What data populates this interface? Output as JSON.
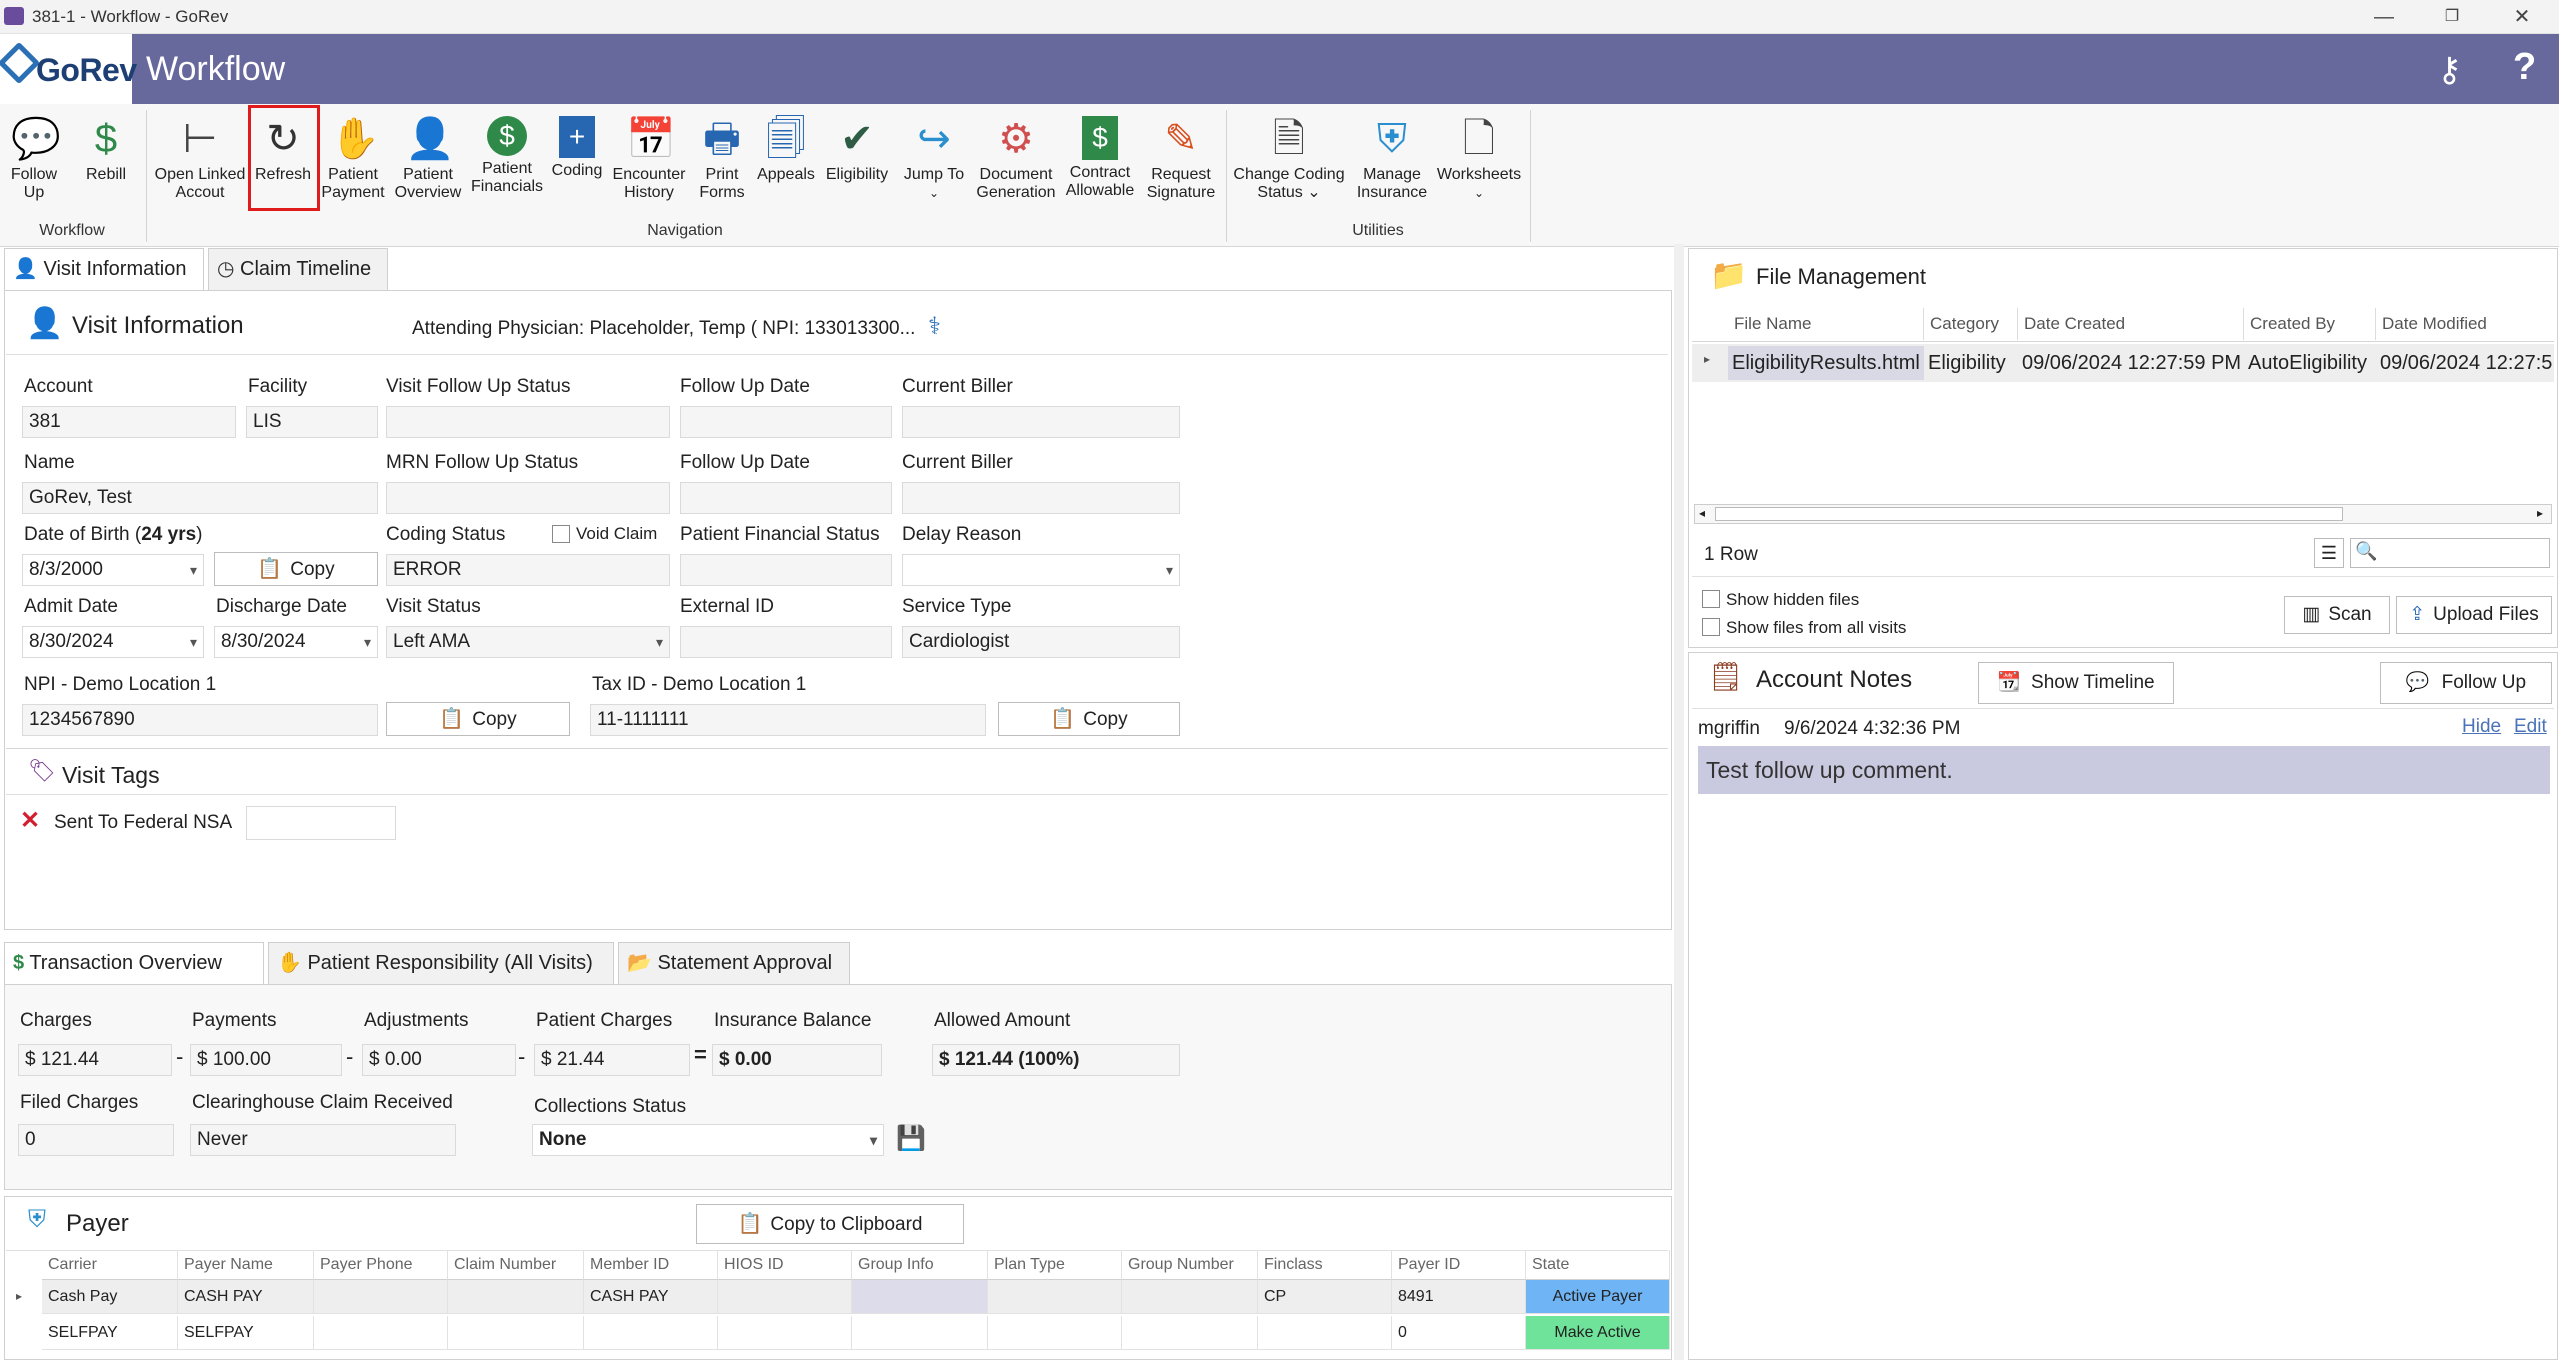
{
  "window": {
    "title": "381-1 - Workflow - GoRev",
    "minimize": "—",
    "maximize": "❐",
    "close": "✕"
  },
  "header": {
    "logo": "GoRev",
    "module": "Workflow"
  },
  "ribbon": {
    "workflow": {
      "group": "Workflow",
      "follow_up": [
        "Follow",
        "Up"
      ],
      "rebill": "Rebill"
    },
    "navigation": {
      "group": "Navigation",
      "open_linked": [
        "Open Linked",
        "Accout"
      ],
      "refresh": "Refresh",
      "patient_payment": [
        "Patient",
        "Payment"
      ],
      "patient_overview": [
        "Patient",
        "Overview"
      ],
      "patient_financials": [
        "Patient",
        "Financials"
      ],
      "coding": "Coding",
      "encounter_history": [
        "Encounter",
        "History"
      ],
      "print_forms": [
        "Print",
        "Forms"
      ],
      "appeals": "Appeals",
      "eligibility": "Eligibility",
      "jump_to": "Jump To",
      "document_generation": [
        "Document",
        "Generation"
      ],
      "contract_allowable": [
        "Contract",
        "Allowable"
      ],
      "request_signature": [
        "Request",
        "Signature"
      ]
    },
    "utilities": {
      "group": "Utilities",
      "change_coding_status": [
        "Change Coding",
        "Status ⌄"
      ],
      "manage_insurance": [
        "Manage",
        "Insurance"
      ],
      "worksheets": "Worksheets"
    }
  },
  "tabs": {
    "visit_information": "Visit Information",
    "claim_timeline": "Claim Timeline"
  },
  "visit_info": {
    "title": "Visit Information",
    "attending": "Attending Physician: Placeholder, Temp ( NPI: 133013300...",
    "account_label": "Account",
    "account": "381",
    "facility_label": "Facility",
    "facility": "LIS",
    "visit_follow_up_status_label": "Visit Follow Up Status",
    "visit_follow_up_status": "",
    "follow_up_date_label": "Follow Up Date",
    "follow_up_date": "",
    "current_biller_label": "Current Biller",
    "current_biller": "",
    "name_label": "Name",
    "name": "GoRev, Test",
    "mrn_follow_up_status_label": "MRN Follow Up Status",
    "mrn_follow_up_status": "",
    "follow_up_date2_label": "Follow Up Date",
    "follow_up_date2": "",
    "current_biller2_label": "Current Biller",
    "current_biller2": "",
    "dob_label": "Date of Birth (",
    "dob_age": "24 yrs",
    "dob_label_end": ")",
    "dob": "8/3/2000",
    "copy": "Copy",
    "coding_status_label": "Coding Status",
    "coding_status": "ERROR",
    "void_claim_label": "Void Claim",
    "patient_financial_status_label": "Patient Financial Status",
    "patient_financial_status": "",
    "delay_reason_label": "Delay Reason",
    "delay_reason": "",
    "admit_date_label": "Admit Date",
    "admit_date": "8/30/2024",
    "discharge_date_label": "Discharge Date",
    "discharge_date": "8/30/2024",
    "visit_status_label": "Visit Status",
    "visit_status": "Left AMA",
    "external_id_label": "External ID",
    "external_id": "",
    "service_type_label": "Service Type",
    "service_type": "Cardiologist",
    "npi_label": "NPI - Demo Location 1",
    "npi": "1234567890",
    "tax_id_label": "Tax ID - Demo Location 1",
    "tax_id": "11-1111111"
  },
  "visit_tags": {
    "title": "Visit Tags",
    "tag": "Sent To Federal NSA",
    "tag_value": ""
  },
  "tabs2": {
    "transaction_overview": "Transaction Overview",
    "patient_responsibility": "Patient Responsibility (All Visits)",
    "statement_approval": "Statement Approval"
  },
  "transactions": {
    "charges_label": "Charges",
    "charges": "$ 121.44",
    "payments_label": "Payments",
    "payments": "$ 100.00",
    "adjustments_label": "Adjustments",
    "adjustments": "$ 0.00",
    "patient_charges_label": "Patient Charges",
    "patient_charges": "$ 21.44",
    "insurance_balance_label": "Insurance Balance",
    "insurance_balance": "$ 0.00",
    "allowed_amount_label": "Allowed Amount",
    "allowed_amount": "$ 121.44 (100%)",
    "op_minus": "-",
    "op_equals": "=",
    "filed_charges_label": "Filed Charges",
    "filed_charges": "0",
    "clearinghouse_label": "Clearinghouse Claim Received",
    "clearinghouse": "Never",
    "collections_status_label": "Collections Status",
    "collections_status": "None"
  },
  "payer": {
    "title": "Payer",
    "copy_clipboard": "Copy to Clipboard",
    "columns": [
      "Carrier",
      "Payer Name",
      "Payer Phone",
      "Claim Number",
      "Member ID",
      "HIOS ID",
      "Group Info",
      "Plan Type",
      "Group Number",
      "Finclass",
      "Payer ID",
      "State"
    ],
    "rows": [
      [
        "Cash Pay",
        "CASH PAY",
        "",
        "",
        "CASH PAY",
        "",
        "",
        "",
        "",
        "CP",
        "8491",
        "Active Payer"
      ],
      [
        "SELFPAY",
        "SELFPAY",
        "",
        "",
        "",
        "",
        "",
        "",
        "",
        "",
        "0",
        "Make Active"
      ]
    ]
  },
  "file_management": {
    "title": "File Management",
    "columns": [
      "File Name",
      "Category",
      "Date Created",
      "Created By",
      "Date Modified"
    ],
    "rows": [
      [
        "EligibilityResults.html",
        "Eligibility",
        "09/06/2024 12:27:59 PM",
        "AutoEligibility",
        "09/06/2024 12:27:5"
      ]
    ],
    "row_count": "1 Row",
    "show_hidden": "Show hidden files",
    "show_all_visits": "Show files from all visits",
    "scan": "Scan",
    "upload": "Upload Files"
  },
  "account_notes": {
    "title": "Account Notes",
    "show_timeline": "Show Timeline",
    "follow_up": "Follow Up",
    "note_author": "mgriffin",
    "note_time": "9/6/2024 4:32:36 PM",
    "hide": "Hide",
    "edit": "Edit",
    "note_text": "Test follow up comment."
  },
  "colors": {
    "header": "#67689c",
    "active_payer": "#6fb4f5",
    "make_active": "#6fe39a",
    "note_bg": "#c9c9e0",
    "highlight": "#e01b1b"
  }
}
